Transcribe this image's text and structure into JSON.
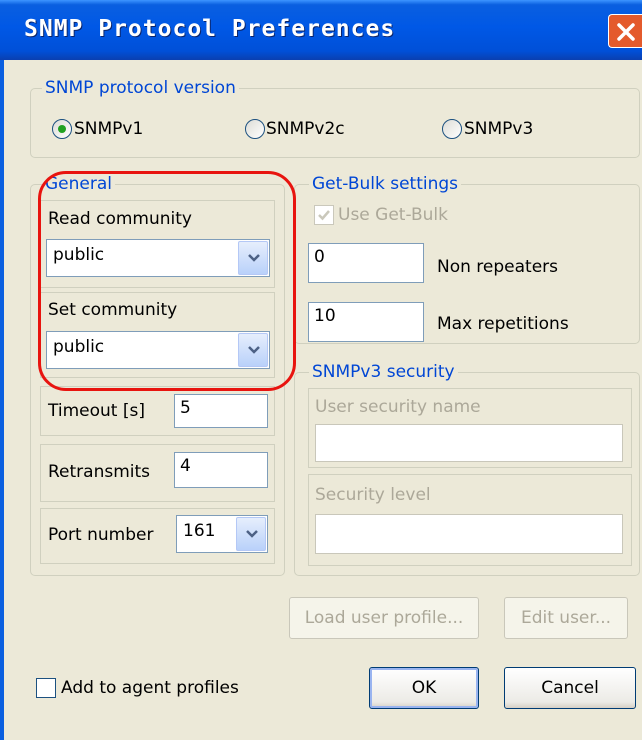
{
  "window": {
    "title": "SNMP Protocol Preferences",
    "close_icon": "close-icon"
  },
  "version_group": {
    "legend": "SNMP protocol version",
    "options": [
      {
        "label": "SNMPv1",
        "selected": true
      },
      {
        "label": "SNMPv2c",
        "selected": false
      },
      {
        "label": "SNMPv3",
        "selected": false
      }
    ]
  },
  "general_group": {
    "legend": "General",
    "read_community": {
      "label": "Read community",
      "value": "public"
    },
    "set_community": {
      "label": "Set community",
      "value": "public"
    },
    "timeout": {
      "label": "Timeout [s]",
      "value": "5"
    },
    "retransmits": {
      "label": "Retransmits",
      "value": "4"
    },
    "port_number": {
      "label": "Port number",
      "value": "161"
    }
  },
  "getbulk_group": {
    "legend": "Get-Bulk settings",
    "use_getbulk": {
      "label": "Use Get-Bulk",
      "checked": true,
      "enabled": false
    },
    "non_repeaters": {
      "label": "Non repeaters",
      "value": "0"
    },
    "max_repetitions": {
      "label": "Max repetitions",
      "value": "10"
    }
  },
  "security_group": {
    "legend": "SNMPv3 security",
    "user_security_name": {
      "label": "User security name",
      "value": ""
    },
    "security_level": {
      "label": "Security level",
      "value": ""
    }
  },
  "buttons": {
    "load_user_profile": "Load user profile...",
    "edit_user": "Edit user...",
    "ok": "OK",
    "cancel": "Cancel"
  },
  "add_to_agent_profiles": {
    "label": "Add to agent profiles",
    "checked": false
  },
  "colors": {
    "title_bar": "#0058e6",
    "group_legend": "#0046d5",
    "annotation": "#e8140f",
    "radio_dot": "#21a121"
  }
}
